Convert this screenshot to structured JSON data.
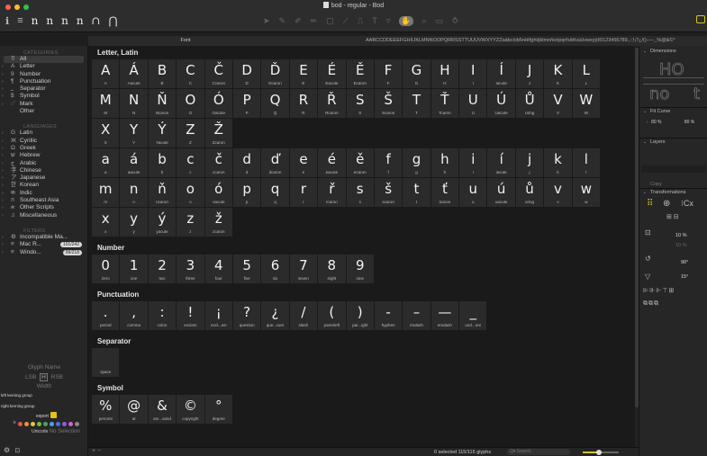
{
  "window": {
    "title": "bod - regular - Bod"
  },
  "toolbar": {
    "left_glyphs": [
      "ℹ",
      "≡",
      "n",
      "n",
      "n",
      "n",
      "⋂",
      "∩"
    ]
  },
  "tabstrip": {
    "font_tab": "Font",
    "preview": "AÁBCČDĎEÉĚFGHIÍJKLMNŇOÓPQRŘSŠTŤUÚŮVWXYÝZŽaábcčdďeéěfghiíjklmnňoópqrřsštťuúůvwxyýž0123456789.,:;!¡?¿/()–—_%@&©°"
  },
  "sidebar": {
    "categories_head": "CATEGORIES",
    "categories": [
      {
        "icon": "⠿",
        "label": "All",
        "selected": true
      },
      {
        "icon": "A",
        "label": "Letter"
      },
      {
        "icon": "9",
        "label": "Number"
      },
      {
        "icon": "¶",
        "label": "Punctuation"
      },
      {
        "icon": "⎵",
        "label": "Separator"
      },
      {
        "icon": "$",
        "label": "Symbol"
      },
      {
        "icon": "◌̈",
        "label": "Mark"
      },
      {
        "icon": "",
        "label": "Other"
      }
    ],
    "languages_head": "LANGUAGES",
    "languages": [
      {
        "icon": "G",
        "label": "Latin"
      },
      {
        "icon": "Ж",
        "label": "Cyrillic"
      },
      {
        "icon": "Ω",
        "label": "Greek"
      },
      {
        "icon": "ש",
        "label": "Hebrew"
      },
      {
        "icon": "ج",
        "label": "Arabic"
      },
      {
        "icon": "字",
        "label": "Chinese"
      },
      {
        "icon": "ア",
        "label": "Japanese"
      },
      {
        "icon": "한",
        "label": "Korean"
      },
      {
        "icon": "क",
        "label": "Indic"
      },
      {
        "icon": "ก",
        "label": "Southeast Asia"
      },
      {
        "icon": "ጵ",
        "label": "Other Scripts"
      },
      {
        "icon": "♫",
        "label": "Miscellaneous"
      }
    ],
    "filters_head": "FILTERS",
    "filters": [
      {
        "icon": "⚙",
        "label": "Incompatible Ma...",
        "count": ""
      },
      {
        "icon": "≡",
        "label": "Mac R...",
        "count": "101/242"
      },
      {
        "icon": "≡",
        "label": "Windo...",
        "count": "99/218"
      }
    ],
    "glyph_name": "Glyph Name",
    "lsb": "LSB",
    "rsb": "RSB",
    "width": "Width",
    "left_kerning": "left kerning group",
    "right_kerning": "right kerning group",
    "export": "export",
    "unicode_label": "Unicode",
    "no_selection": "No Selection"
  },
  "sections": [
    {
      "title": "Letter, Latin",
      "glyphs": [
        [
          "A",
          "A"
        ],
        [
          "Á",
          "Aacute"
        ],
        [
          "B",
          "B"
        ],
        [
          "C",
          "C"
        ],
        [
          "Č",
          "Ccaron"
        ],
        [
          "D",
          "D"
        ],
        [
          "Ď",
          "Dcaron"
        ],
        [
          "E",
          "E"
        ],
        [
          "É",
          "Eacute"
        ],
        [
          "Ě",
          "Ecaron"
        ],
        [
          "F",
          "F"
        ],
        [
          "G",
          "G"
        ],
        [
          "H",
          "H"
        ],
        [
          "I",
          "I"
        ],
        [
          "Í",
          "Iacute"
        ],
        [
          "J",
          "J"
        ],
        [
          "K",
          "K"
        ],
        [
          "L",
          "L"
        ],
        [
          "M",
          "M"
        ],
        [
          "N",
          "N"
        ],
        [
          "Ň",
          "Ncaron"
        ],
        [
          "O",
          "O"
        ],
        [
          "Ó",
          "Oacute"
        ],
        [
          "P",
          "P"
        ],
        [
          "Q",
          "Q"
        ],
        [
          "R",
          "R"
        ],
        [
          "Ř",
          "Rcaron"
        ],
        [
          "S",
          "S"
        ],
        [
          "Š",
          "Scaron"
        ],
        [
          "T",
          "T"
        ],
        [
          "Ť",
          "Tcaron"
        ],
        [
          "U",
          "U"
        ],
        [
          "Ú",
          "Uacute"
        ],
        [
          "Ů",
          "Uring"
        ],
        [
          "V",
          "V"
        ],
        [
          "W",
          "W"
        ],
        [
          "X",
          "X"
        ],
        [
          "Y",
          "Y"
        ],
        [
          "Ý",
          "Yacute"
        ],
        [
          "Z",
          "Z"
        ],
        [
          "Ž",
          "Zcaron"
        ],
        [
          "a",
          "a"
        ],
        [
          "á",
          "aacute"
        ],
        [
          "b",
          "b"
        ],
        [
          "c",
          "c"
        ],
        [
          "č",
          "ccaron"
        ],
        [
          "d",
          "d"
        ],
        [
          "ď",
          "dcaron"
        ],
        [
          "e",
          "e"
        ],
        [
          "é",
          "eacute"
        ],
        [
          "ě",
          "ecaron"
        ],
        [
          "f",
          "f"
        ],
        [
          "g",
          "g"
        ],
        [
          "h",
          "h"
        ],
        [
          "i",
          "i"
        ],
        [
          "í",
          "iacute"
        ],
        [
          "j",
          "j"
        ],
        [
          "k",
          "k"
        ],
        [
          "l",
          "l"
        ],
        [
          "m",
          "m"
        ],
        [
          "n",
          "n"
        ],
        [
          "ň",
          "ncaron"
        ],
        [
          "o",
          "o"
        ],
        [
          "ó",
          "oacute"
        ],
        [
          "p",
          "p"
        ],
        [
          "q",
          "q"
        ],
        [
          "r",
          "r"
        ],
        [
          "ř",
          "rcaron"
        ],
        [
          "s",
          "s"
        ],
        [
          "š",
          "scaron"
        ],
        [
          "t",
          "t"
        ],
        [
          "ť",
          "tcaron"
        ],
        [
          "u",
          "u"
        ],
        [
          "ú",
          "uacute"
        ],
        [
          "ů",
          "uring"
        ],
        [
          "v",
          "v"
        ],
        [
          "w",
          "w"
        ],
        [
          "x",
          "x"
        ],
        [
          "y",
          "y"
        ],
        [
          "ý",
          "yacute"
        ],
        [
          "z",
          "z"
        ],
        [
          "ž",
          "zcaron"
        ]
      ],
      "breaks": [
        41
      ]
    },
    {
      "title": "Number",
      "glyphs": [
        [
          "0",
          "zero"
        ],
        [
          "1",
          "one"
        ],
        [
          "2",
          "two"
        ],
        [
          "3",
          "three"
        ],
        [
          "4",
          "four"
        ],
        [
          "5",
          "five"
        ],
        [
          "6",
          "six"
        ],
        [
          "7",
          "seven"
        ],
        [
          "8",
          "eight"
        ],
        [
          "9",
          "nine"
        ]
      ]
    },
    {
      "title": "Punctuation",
      "glyphs": [
        [
          ".",
          "period"
        ],
        [
          ",",
          "comma"
        ],
        [
          ":",
          "colon"
        ],
        [
          "!",
          "exclam"
        ],
        [
          "¡",
          "excl...wn"
        ],
        [
          "?",
          "question"
        ],
        [
          "¿",
          "que...own"
        ],
        [
          "/",
          "slash"
        ],
        [
          "(",
          "parenleft"
        ],
        [
          ")",
          "par...ight"
        ],
        [
          "-",
          "hyphen"
        ],
        [
          "–",
          "endash"
        ],
        [
          "—",
          "emdash"
        ],
        [
          "_",
          "und...ore"
        ]
      ]
    },
    {
      "title": "Separator",
      "glyphs": [
        [
          " ",
          "space"
        ]
      ]
    },
    {
      "title": "Symbol",
      "glyphs": [
        [
          "%",
          "percent"
        ],
        [
          "@",
          "at"
        ],
        [
          "&",
          "am...sand"
        ],
        [
          "©",
          "copyright"
        ],
        [
          "°",
          "degree"
        ]
      ]
    }
  ],
  "statusbar": {
    "plus_minus": "+ −",
    "selection": "0 selected 115/115 glyphs",
    "search_placeholder": "Q▾ Search",
    "zoom_fraction": 0.45
  },
  "right_panel": {
    "dimensions": "Dimensions",
    "fit_curve": "Fit Curve",
    "fit_left": "80 %",
    "fit_right": "80 %",
    "layers": "Layers",
    "copy": "Copy",
    "transformations": "Transformations",
    "scale": "10 %",
    "scale2": "10 %",
    "rotate": "90°",
    "slant": "15°",
    "preview_ho": "HO",
    "preview_no": "no",
    "preview_t": "t"
  },
  "colors": {
    "accent": "#d8c420",
    "label_colors": [
      "#e05a4f",
      "#e8923c",
      "#e4c74a",
      "#6fbf4c",
      "#4c9e68",
      "#4aa4e0",
      "#4f6fe0",
      "#8a5fe0",
      "#d85fd0",
      "#888888"
    ]
  }
}
